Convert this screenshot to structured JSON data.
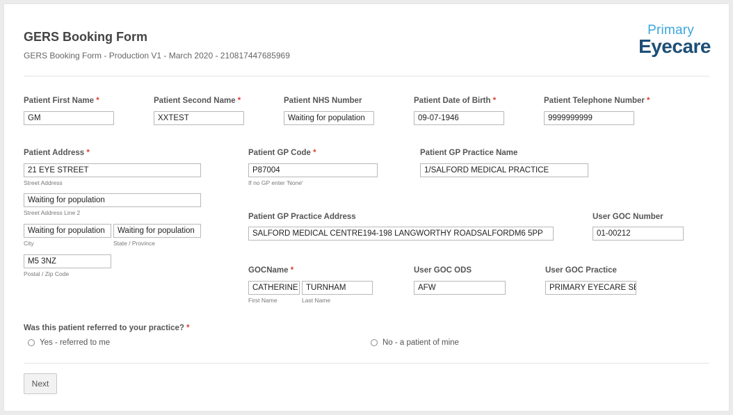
{
  "form": {
    "title": "GERS Booking Form",
    "subtitle": "GERS Booking Form - Production V1 - March 2020 - 210817447685969",
    "logo": {
      "line1": "Primary",
      "line2": "Eyecare"
    }
  },
  "fields": {
    "first_name": {
      "label": "Patient First Name",
      "value": "GM"
    },
    "second_name": {
      "label": "Patient Second Name",
      "value": "XXTEST"
    },
    "nhs_number": {
      "label": "Patient NHS Number",
      "value": "Waiting for population"
    },
    "dob": {
      "label": "Patient Date of Birth",
      "value": "09-07-1946"
    },
    "telephone": {
      "label": "Patient Telephone Number",
      "value": "9999999999"
    },
    "address": {
      "label": "Patient Address",
      "street": "21 EYE STREET",
      "street_sub": "Street Address",
      "line2": "Waiting for population",
      "line2_sub": "Street Address Line 2",
      "city": "Waiting for population",
      "city_sub": "City",
      "state": "Waiting for population",
      "state_sub": "State / Province",
      "postal": "M5 3NZ",
      "postal_sub": "Postal / Zip Code"
    },
    "gp_code": {
      "label": "Patient GP Code",
      "value": "P87004",
      "sub": "If no GP enter 'None'"
    },
    "gp_practice_name": {
      "label": "Patient GP Practice Name",
      "value": "1/SALFORD MEDICAL PRACTICE"
    },
    "gp_practice_address": {
      "label": "Patient GP Practice Address",
      "value": "SALFORD MEDICAL CENTRE194-198 LANGWORTHY ROADSALFORDM6 5PP"
    },
    "goc_number": {
      "label": "User GOC Number",
      "value": "01-00212"
    },
    "goc_name": {
      "label": "GOCName",
      "first": "CATHERINE",
      "first_sub": "First Name",
      "last": "TURNHAM",
      "last_sub": "Last Name"
    },
    "goc_ods": {
      "label": "User GOC ODS",
      "value": "AFW"
    },
    "goc_practice": {
      "label": "User GOC Practice",
      "value": "PRIMARY EYECARE SERVICES"
    }
  },
  "referral": {
    "question": "Was this patient referred to your practice?",
    "options": [
      "Yes - referred to me",
      "No - a patient of mine"
    ]
  },
  "required_marker": "*",
  "next_label": "Next"
}
